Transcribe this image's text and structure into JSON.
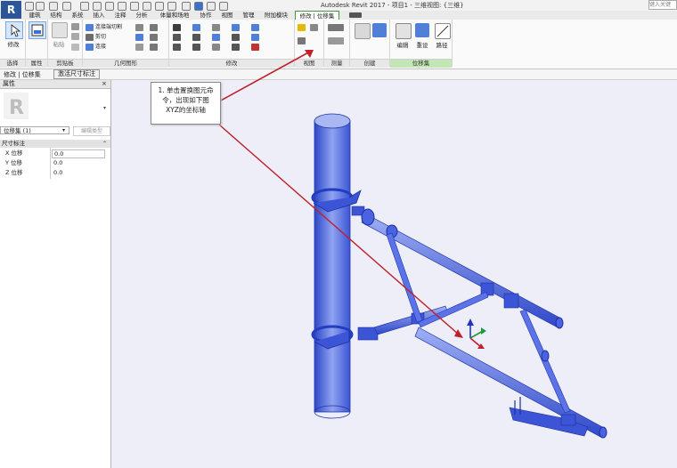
{
  "app": {
    "logo_letter": "R",
    "title": "Autodesk Revit 2017 -    项目1 - 三维视图: {三维}",
    "search_placeholder": "键入关键"
  },
  "tabs": [
    "建筑",
    "结构",
    "系统",
    "插入",
    "注释",
    "分析",
    "体量和场地",
    "协作",
    "视图",
    "管理",
    "附加模块",
    "修改 | 位移集"
  ],
  "ribbon": {
    "modify_label": "修改",
    "paste_label": "粘贴",
    "geometry": {
      "join_cut": "连接端切割",
      "cut": "剪切",
      "join": "连接"
    },
    "panels": {
      "select": "选择",
      "properties": "属性",
      "clipboard": "剪贴板",
      "geometry": "几何图形",
      "modify": "修改",
      "view": "视图",
      "measure": "测量",
      "create": "创建",
      "displacement_set": "位移集"
    },
    "displacement": {
      "edit": "编辑",
      "reset": "重设",
      "path": "路径"
    }
  },
  "options_bar": {
    "context": "修改 | 位移集",
    "button": "激活尺寸标注"
  },
  "properties": {
    "header": "属性",
    "type_selector": "位移集 (1)",
    "edit_type": "编辑类型",
    "group": "尺寸标注",
    "rows": [
      {
        "label": "X 位移",
        "value": "0.0"
      },
      {
        "label": "Y 位移",
        "value": "0.0"
      },
      {
        "label": "Z 位移",
        "value": "0.0"
      }
    ]
  },
  "callout": {
    "lines": [
      "1. 单击置换图元命",
      "令，出现如下图",
      "XYZ的坐标轴"
    ]
  },
  "colors": {
    "model_blue": "#4a63e0",
    "arrow_red": "#c0202a",
    "ribbon_panel_green": "#c3e6b5",
    "view_background": "#eeeef8"
  }
}
